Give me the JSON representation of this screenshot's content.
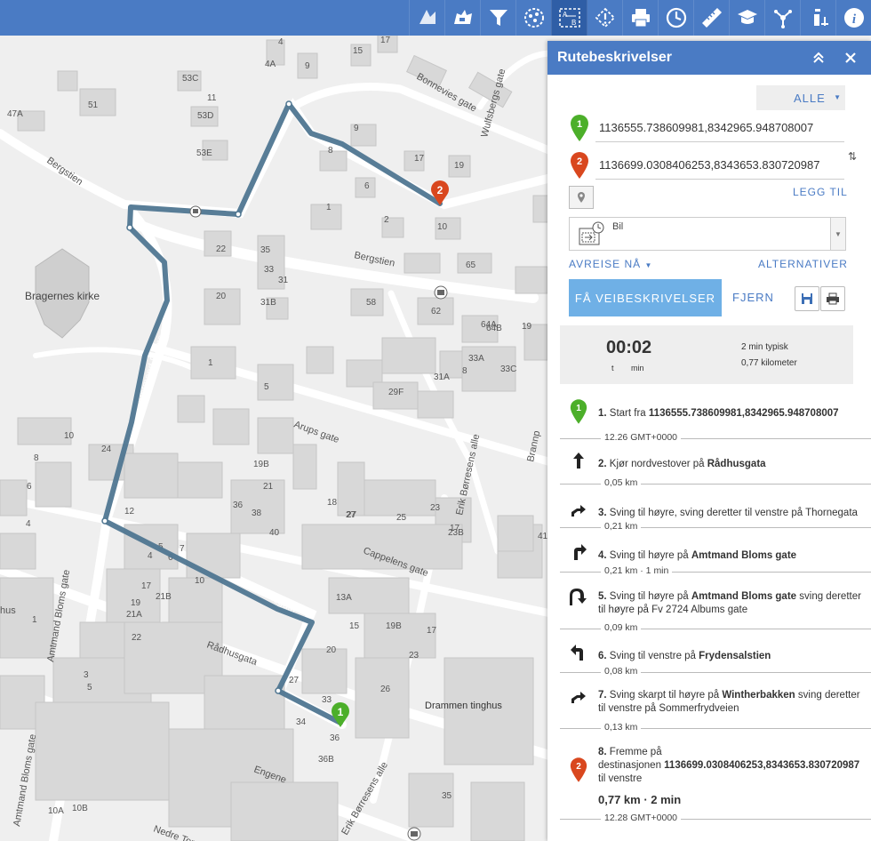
{
  "toolbar": {
    "tools": [
      {
        "name": "basemap-gallery-icon"
      },
      {
        "name": "layer-list-icon"
      },
      {
        "name": "filter-icon"
      },
      {
        "name": "analysis-icon"
      },
      {
        "name": "directions-icon",
        "active": true
      },
      {
        "name": "incident-report-icon"
      },
      {
        "name": "print-icon"
      },
      {
        "name": "time-slider-icon"
      },
      {
        "name": "measure-icon"
      },
      {
        "name": "education-icon"
      },
      {
        "name": "network-icon"
      },
      {
        "name": "info-person-icon"
      },
      {
        "name": "about-icon"
      }
    ]
  },
  "map": {
    "labels": {
      "bragernes_kirke": "Bragernes kirke",
      "bergstien_w": "Bergstien",
      "bergstien_e": "Bergstien",
      "bonnevies": "Bonnevies gate",
      "wulfsbergs": "Wulfsbergs gate",
      "arups": "Arups gate",
      "cappelens": "Cappelens gate",
      "amtmand_upper": "Amtmand Bloms gate",
      "amtmand_lower": "Amtmand Bloms gate",
      "amtmand_left": "Amtmand Bloms gate",
      "thornegata": "Thornegata",
      "radhusgata": "Rådhusgata",
      "engene": "Engene",
      "nedre_torggata": "Nedre Torggata",
      "erik_borresens": "Erik Børresens alle",
      "erik_bornsens2": "Erik Børresens alle",
      "drammen_tinghus": "Drammen tinghus",
      "hus": "hus",
      "brann": "Brannp"
    },
    "numbers": [
      {
        "t": "4"
      },
      {
        "t": "17"
      },
      {
        "t": "4A"
      },
      {
        "t": "9"
      },
      {
        "t": "15"
      },
      {
        "t": "53C"
      },
      {
        "t": "11"
      },
      {
        "t": "51"
      },
      {
        "t": "47A"
      },
      {
        "t": "53D"
      },
      {
        "t": "53E"
      },
      {
        "t": "9"
      },
      {
        "t": "8"
      },
      {
        "t": "6"
      },
      {
        "t": "1"
      },
      {
        "t": "2"
      },
      {
        "t": "10"
      },
      {
        "t": "65"
      },
      {
        "t": "17"
      },
      {
        "t": "19"
      },
      {
        "t": "22"
      },
      {
        "t": "35"
      },
      {
        "t": "33"
      },
      {
        "t": "31"
      },
      {
        "t": "20"
      },
      {
        "t": "31B"
      },
      {
        "t": "58"
      },
      {
        "t": "62"
      },
      {
        "t": "64A"
      },
      {
        "t": "64B"
      },
      {
        "t": "1"
      },
      {
        "t": "5"
      },
      {
        "t": "33A"
      },
      {
        "t": "33C"
      },
      {
        "t": "29F"
      },
      {
        "t": "31A"
      },
      {
        "t": "10"
      },
      {
        "t": "24"
      },
      {
        "t": "8"
      },
      {
        "t": "6"
      },
      {
        "t": "4"
      },
      {
        "t": "19B"
      },
      {
        "t": "21"
      },
      {
        "t": "18"
      },
      {
        "t": "27"
      },
      {
        "t": "25"
      },
      {
        "t": "23"
      },
      {
        "t": "23B"
      },
      {
        "t": "12"
      },
      {
        "t": "36"
      },
      {
        "t": "38"
      },
      {
        "t": "40"
      },
      {
        "t": "5"
      },
      {
        "t": "7"
      },
      {
        "t": "4"
      },
      {
        "t": "6"
      },
      {
        "t": "10"
      },
      {
        "t": "17"
      },
      {
        "t": "21B"
      },
      {
        "t": "19"
      },
      {
        "t": "21A"
      },
      {
        "t": "1"
      },
      {
        "t": "22"
      },
      {
        "t": "3"
      },
      {
        "t": "5"
      },
      {
        "t": "13A"
      },
      {
        "t": "15"
      },
      {
        "t": "19B"
      },
      {
        "t": "23"
      },
      {
        "t": "17"
      },
      {
        "t": "20"
      },
      {
        "t": "27"
      },
      {
        "t": "33"
      },
      {
        "t": "26"
      },
      {
        "t": "34"
      },
      {
        "t": "36"
      },
      {
        "t": "36B"
      },
      {
        "t": "35"
      },
      {
        "t": "10A"
      },
      {
        "t": "10B"
      },
      {
        "t": "41"
      },
      {
        "t": "27"
      },
      {
        "t": "17"
      },
      {
        "t": "8"
      },
      {
        "t": "19"
      }
    ]
  },
  "panel": {
    "title": "Rutebeskrivelser",
    "alle_label": "ALLE",
    "stop_start": "1136555.738609981,8342965.948708007",
    "stop_end": "1136699.0308406253,8343653.830720987",
    "legg_til": "LEGG TIL",
    "travel_mode": "Bil",
    "avreise": "AVREISE NÅ",
    "alternativer": "ALTERNATIVER",
    "get_directions": "FÅ VEIBESKRIVELSER",
    "fjern": "FJERN",
    "summary": {
      "time": "00:02",
      "t_label": "t",
      "min_label": "min",
      "typical": "2 min typisk",
      "distance": "0,77 kilometer"
    },
    "steps": [
      {
        "num": "1.",
        "pre": "Start fra ",
        "bold": "1136555.738609981,8342965.948708007",
        "post": "",
        "line2": ""
      },
      {
        "num": "2.",
        "pre": "Kjør nordvestover på ",
        "bold": "Rådhusgata",
        "post": "",
        "line2": ""
      },
      {
        "num": "3.",
        "pre": "Sving til høyre, sving deretter til venstre på Thornegata",
        "bold": "",
        "post": "",
        "line2": ""
      },
      {
        "num": "4.",
        "pre": "Sving til høyre på ",
        "bold": "Amtmand Bloms gate",
        "post": "",
        "line2": ""
      },
      {
        "num": "5.",
        "pre": "Sving til høyre på ",
        "bold": "Amtmand Bloms gate",
        "post": "  sving deretter",
        "line2": "til høyre på Fv 2724 Albums gate"
      },
      {
        "num": "6.",
        "pre": "Sving til venstre på ",
        "bold": "Frydensalstien",
        "post": "",
        "line2": ""
      },
      {
        "num": "7.",
        "pre": "Sving skarpt til høyre på ",
        "bold": "Wintherbakken",
        "post": "  sving deretter",
        "line2": "til venstre på Sommerfrydveien"
      }
    ],
    "dists": [
      "12.26 GMT+0000",
      "0,05 km",
      "0,21 km",
      "0,21 km · 1 min",
      "0,09 km",
      "0,08 km",
      "0,13 km"
    ],
    "final": {
      "num": "8.",
      "line1": "Fremme på",
      "line2_pre": "destinasjonen ",
      "line2_bold": "1136699.0308406253,8343653.830720987",
      "line3": "til venstre",
      "total": "0,77 km · 2 min",
      "arrival": "12.28 GMT+0000"
    },
    "colors": {
      "accent": "#4a7bc4",
      "button": "#6fb0e6",
      "route": "#4f7691",
      "start_marker": "#4caf2a",
      "end_marker": "#d9471e"
    }
  }
}
